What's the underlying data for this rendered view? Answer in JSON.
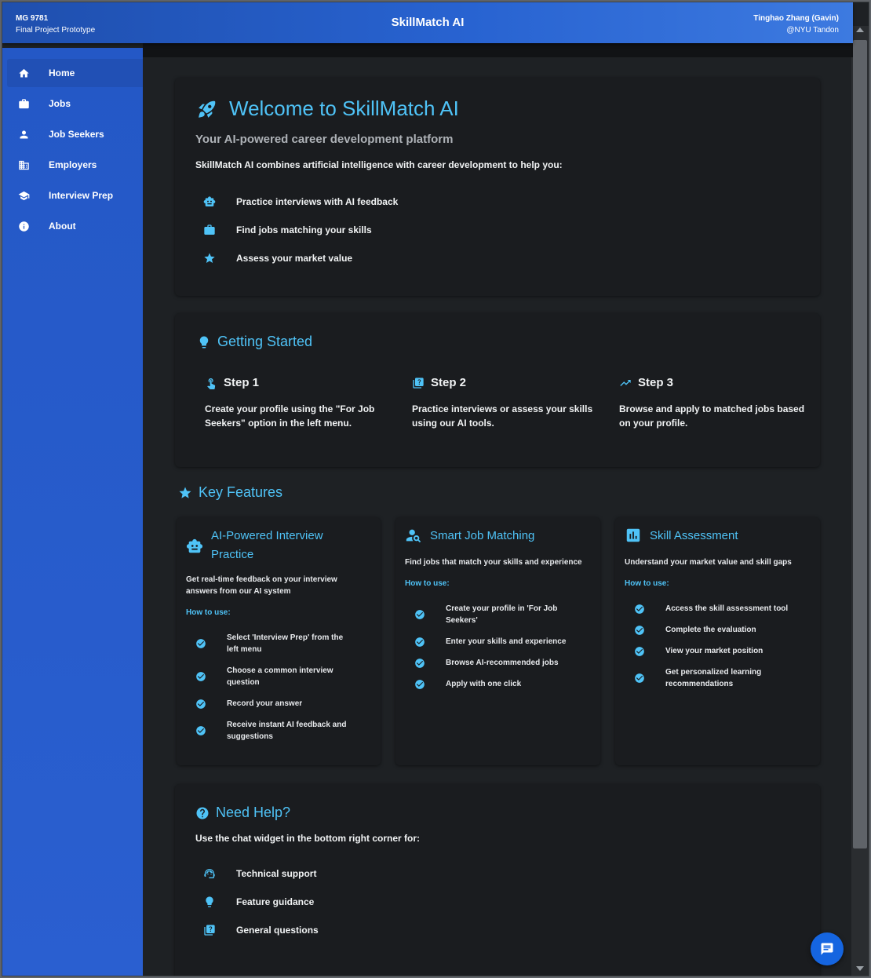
{
  "header": {
    "course": "MG 9781",
    "course_subtitle": "Final Project Prototype",
    "app_title": "SkillMatch AI",
    "user_name": "Tinghao Zhang (Gavin)",
    "user_org": "@NYU Tandon"
  },
  "sidebar": {
    "items": [
      {
        "label": "Home",
        "icon": "home-icon",
        "active": true
      },
      {
        "label": "Jobs",
        "icon": "briefcase-icon"
      },
      {
        "label": "Job Seekers",
        "icon": "person-icon"
      },
      {
        "label": "Employers",
        "icon": "building-icon"
      },
      {
        "label": "Interview Prep",
        "icon": "school-icon"
      },
      {
        "label": "About",
        "icon": "info-icon"
      }
    ]
  },
  "welcome": {
    "title": "Welcome to SkillMatch AI",
    "subtitle": "Your AI-powered career development platform",
    "intro": "SkillMatch AI combines artificial intelligence with career development to help you:",
    "bullets": [
      {
        "text": "Practice interviews with AI feedback",
        "icon": "robot-icon"
      },
      {
        "text": "Find jobs matching your skills",
        "icon": "briefcase-icon"
      },
      {
        "text": "Assess your market value",
        "icon": "star-icon"
      }
    ]
  },
  "getting_started": {
    "title": "Getting Started",
    "steps": [
      {
        "title": "Step 1",
        "text": "Create your profile using the \"For Job Seekers\" option in the left menu.",
        "icon": "touch-icon"
      },
      {
        "title": "Step 2",
        "text": "Practice interviews or assess your skills using our AI tools.",
        "icon": "quiz-icon"
      },
      {
        "title": "Step 3",
        "text": "Browse and apply to matched jobs based on your profile.",
        "icon": "trending-up-icon"
      }
    ]
  },
  "key_features": {
    "title": "Key Features",
    "how_to_label": "How to use:",
    "features": [
      {
        "title_line1": "AI-Powered Interview",
        "title_line2": "Practice",
        "desc_line1": "Get real-time feedback on your interview",
        "desc_line2": "answers from our AI system",
        "steps": [
          [
            "Select 'Interview Prep' from the",
            "left menu"
          ],
          [
            "Choose a common interview",
            "question"
          ],
          [
            "Record your answer",
            ""
          ],
          [
            "Receive instant AI feedback and",
            "suggestions"
          ]
        ]
      },
      {
        "title_line1": "Smart Job Matching",
        "desc_line1": "Find jobs that match your skills and experience",
        "steps": [
          [
            "Create your profile in 'For Job",
            "Seekers'"
          ],
          [
            "Enter your skills and experience",
            ""
          ],
          [
            "Browse AI-recommended jobs",
            ""
          ],
          [
            "Apply with one click",
            ""
          ]
        ]
      },
      {
        "title_line1": "Skill Assessment",
        "desc_line1": "Understand your market value and skill gaps",
        "steps": [
          [
            "Access the skill assessment tool",
            ""
          ],
          [
            "Complete the evaluation",
            ""
          ],
          [
            "View your market position",
            ""
          ],
          [
            "Get personalized learning",
            "recommendations"
          ]
        ]
      }
    ]
  },
  "help": {
    "title": "Need Help?",
    "intro": "Use the chat widget in the bottom right corner for:",
    "items": [
      {
        "text": "Technical support",
        "icon": "support-agent-icon"
      },
      {
        "text": "Feature guidance",
        "icon": "lightbulb-icon"
      },
      {
        "text": "General questions",
        "icon": "quiz-icon"
      }
    ]
  },
  "colors": {
    "accent": "#4fc3f7",
    "sidebar": "#2a5fd0",
    "background": "#1e2124",
    "card": "#1a1c1f"
  }
}
